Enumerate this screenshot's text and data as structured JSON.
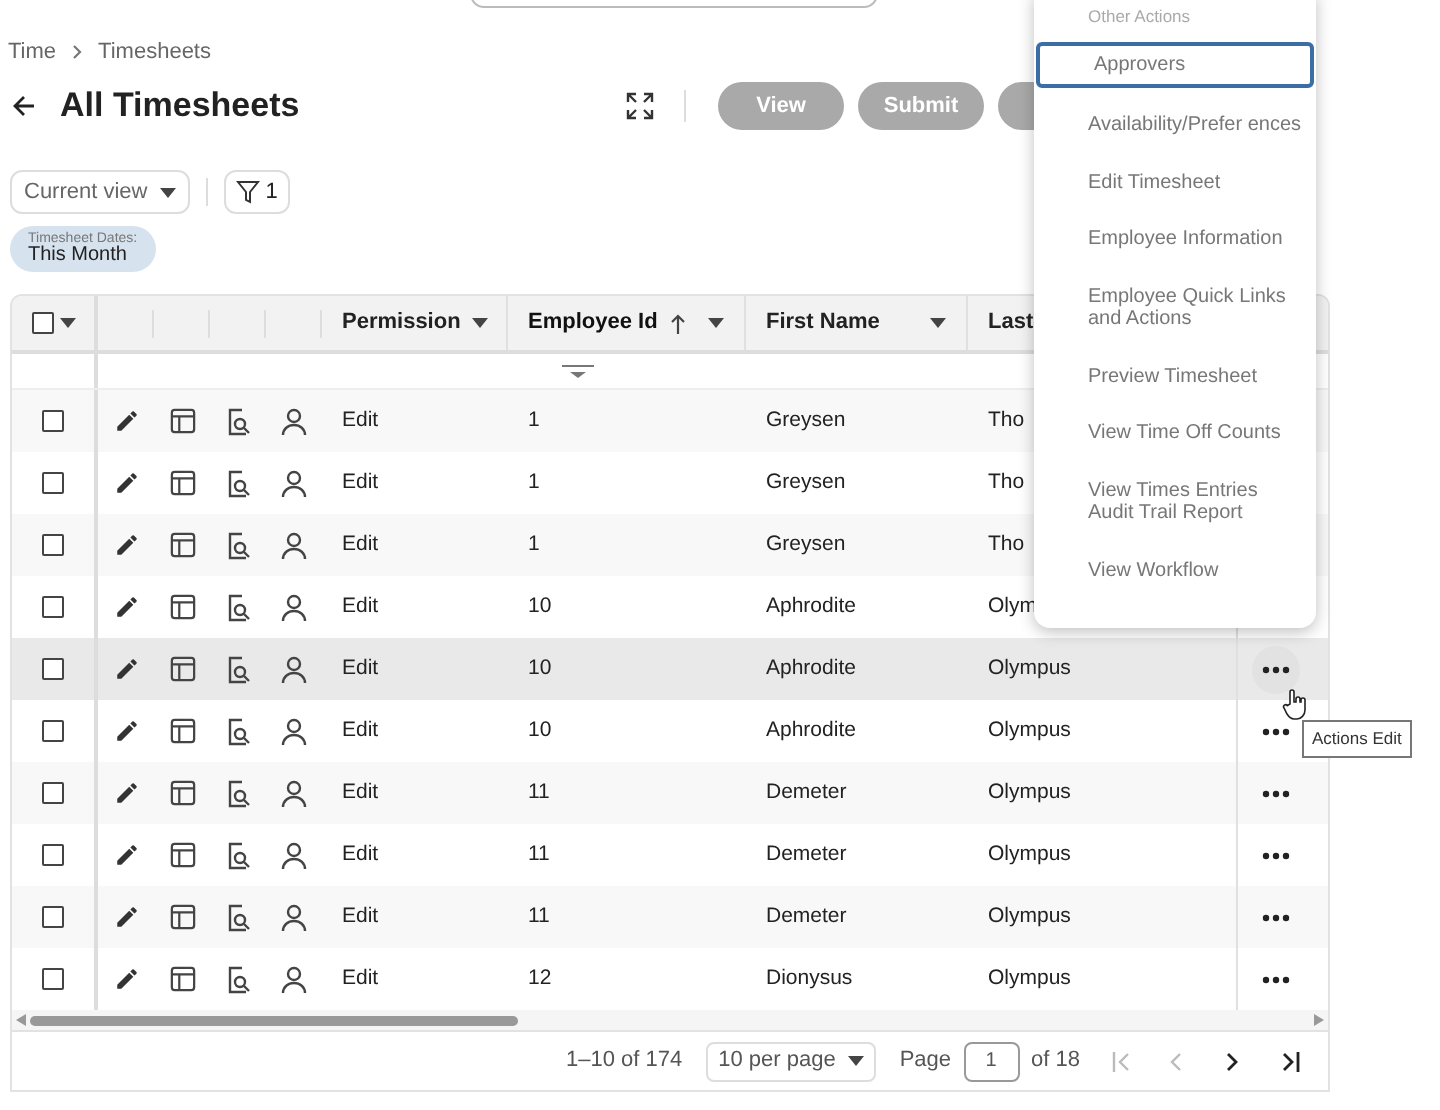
{
  "breadcrumb": [
    "Time",
    "Timesheets"
  ],
  "title": "All Timesheets",
  "toolbar_buttons": [
    "View",
    "Submit"
  ],
  "view_select": "Current view",
  "filter_count": "1",
  "filter_chip": {
    "label": "Timesheet Dates:",
    "value": "This Month"
  },
  "table": {
    "all_checked": false,
    "columns": [
      {
        "label": "Permission",
        "sorted": false
      },
      {
        "label": "Employee Id",
        "sorted": true
      },
      {
        "label": "First Name",
        "sorted": false
      },
      {
        "label": "Last",
        "sorted": false
      }
    ],
    "rows": [
      {
        "checked": false,
        "permission": "Edit",
        "employee_id": "1",
        "first_name": "Greysen",
        "last": "Tho",
        "actions": false,
        "hovered": false
      },
      {
        "checked": false,
        "permission": "Edit",
        "employee_id": "1",
        "first_name": "Greysen",
        "last": "Tho",
        "actions": false,
        "hovered": false
      },
      {
        "checked": false,
        "permission": "Edit",
        "employee_id": "1",
        "first_name": "Greysen",
        "last": "Tho",
        "actions": false,
        "hovered": false
      },
      {
        "checked": false,
        "permission": "Edit",
        "employee_id": "10",
        "first_name": "Aphrodite",
        "last": "Olym",
        "actions": false,
        "hovered": false
      },
      {
        "checked": false,
        "permission": "Edit",
        "employee_id": "10",
        "first_name": "Aphrodite",
        "last": "Olympus",
        "actions": true,
        "hovered": true
      },
      {
        "checked": false,
        "permission": "Edit",
        "employee_id": "10",
        "first_name": "Aphrodite",
        "last": "Olympus",
        "actions": true,
        "hovered": false
      },
      {
        "checked": false,
        "permission": "Edit",
        "employee_id": "11",
        "first_name": "Demeter",
        "last": "Olympus",
        "actions": true,
        "hovered": false
      },
      {
        "checked": false,
        "permission": "Edit",
        "employee_id": "11",
        "first_name": "Demeter",
        "last": "Olympus",
        "actions": true,
        "hovered": false
      },
      {
        "checked": false,
        "permission": "Edit",
        "employee_id": "11",
        "first_name": "Demeter",
        "last": "Olympus",
        "actions": true,
        "hovered": false
      },
      {
        "checked": false,
        "permission": "Edit",
        "employee_id": "12",
        "first_name": "Dionysus",
        "last": "Olympus",
        "actions": true,
        "hovered": false
      }
    ]
  },
  "tooltip": "Actions Edit",
  "menu": {
    "heading": "Other Actions",
    "items": [
      {
        "label": "Approvers",
        "selected": true
      },
      {
        "label": "Availability/Prefer ences",
        "selected": false
      },
      {
        "label": "Edit Timesheet",
        "selected": false
      },
      {
        "label": "Employee Information",
        "selected": false
      },
      {
        "label": "Employee Quick Links and Actions",
        "selected": false
      },
      {
        "label": "Preview Timesheet",
        "selected": false
      },
      {
        "label": "View Time Off Counts",
        "selected": false
      },
      {
        "label": "View Times Entries Audit Trail Report",
        "selected": false
      },
      {
        "label": "View Workflow",
        "selected": false
      }
    ]
  },
  "pagination": {
    "range": "1–10 of 174",
    "per_page": "10 per page",
    "page_label": "Page",
    "page": "1",
    "of": "of 18"
  }
}
